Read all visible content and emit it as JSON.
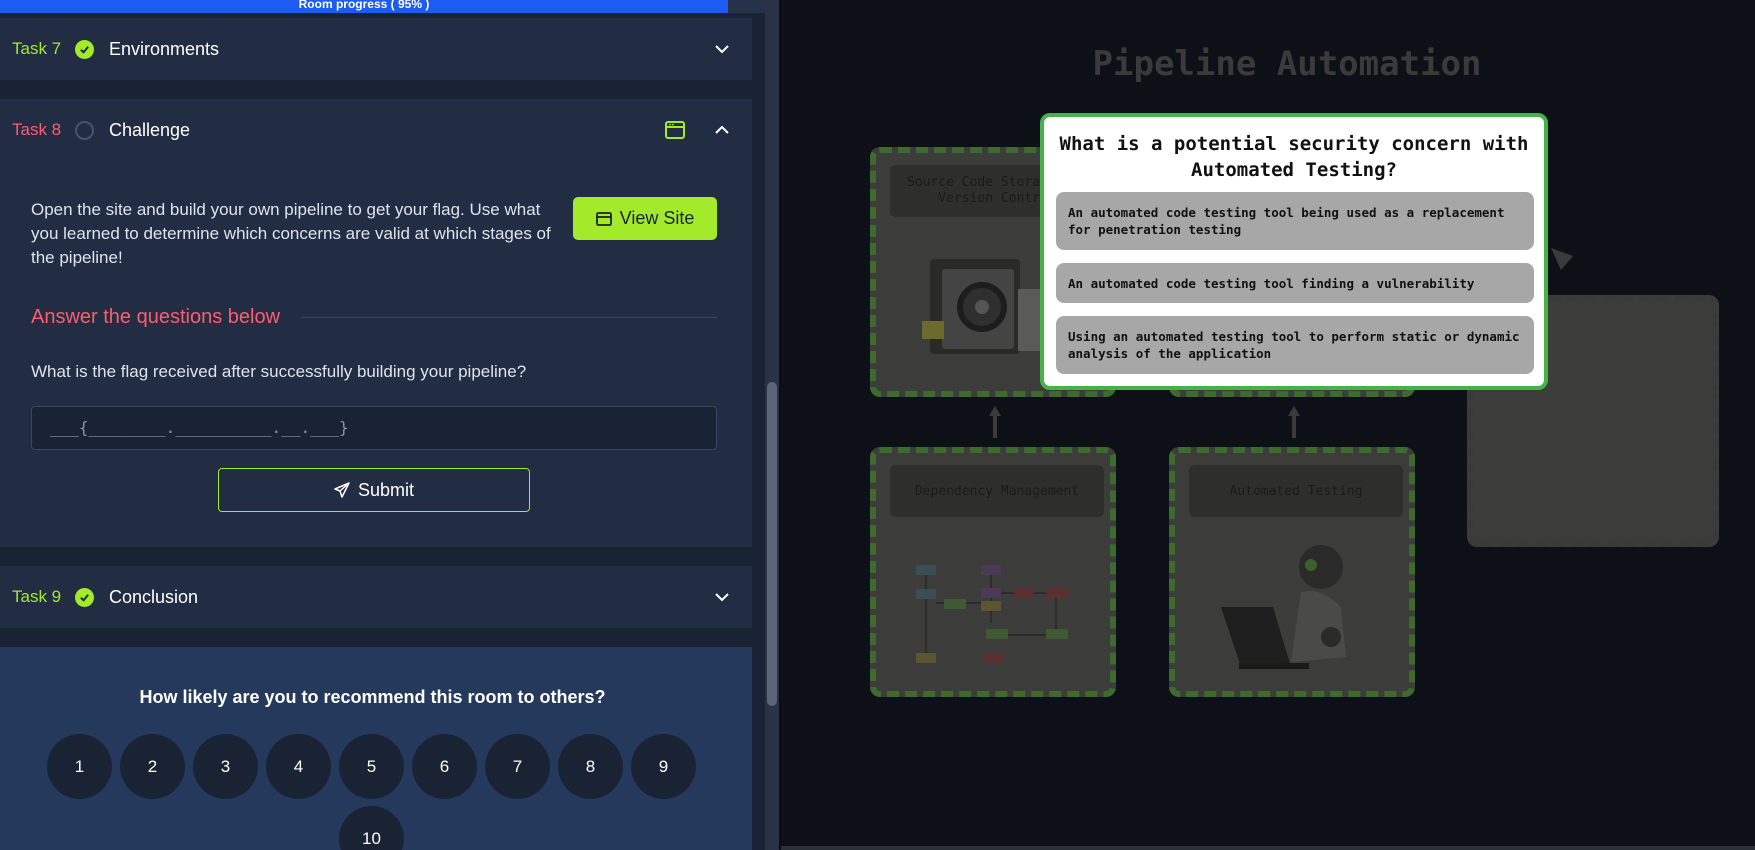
{
  "progress": {
    "label": "Room progress ( 95% )",
    "value_percent": 95
  },
  "tasks": {
    "task7": {
      "num": "Task 7",
      "title": "Environments",
      "status": "complete"
    },
    "task8": {
      "num": "Task 8",
      "title": "Challenge",
      "status": "incomplete",
      "body": "Open the site and build your own pipeline to get your flag. Use what you learned to determine which concerns are valid at which stages of the pipeline!",
      "view_site": "View Site",
      "answer_heading": "Answer the questions below",
      "question": "What is the flag received after successfully building your pipeline?",
      "answer_placeholder": "___{________.__________.__.___}",
      "submit": "Submit"
    },
    "task9": {
      "num": "Task 9",
      "title": "Conclusion",
      "status": "complete"
    }
  },
  "recommend": {
    "question": "How likely are you to recommend this room to others?",
    "options": [
      "1",
      "2",
      "3",
      "4",
      "5",
      "6",
      "7",
      "8",
      "9",
      "10"
    ]
  },
  "game": {
    "title": "Pipeline Automation",
    "stages": {
      "source": "Source Code Storage and Version Control",
      "dependency": "Dependency Management",
      "testing": "Automated Testing"
    },
    "popup": {
      "question": "What is a potential security concern with Automated Testing?",
      "options": [
        "An automated code testing tool being used as a replacement for penetration testing",
        "An automated code testing tool finding a vulnerability",
        "Using an automated testing tool to perform static or dynamic analysis of the application"
      ]
    }
  },
  "colors": {
    "accent_green": "#a3ea2a",
    "accent_red": "#ff5c6c",
    "progress_blue": "#1d5bf2",
    "popup_border": "#46b348"
  },
  "icons": [
    "check-circle-icon",
    "empty-circle-icon",
    "chevron-down-icon",
    "chevron-up-icon",
    "window-icon",
    "send-icon",
    "arrow-up-icon"
  ]
}
